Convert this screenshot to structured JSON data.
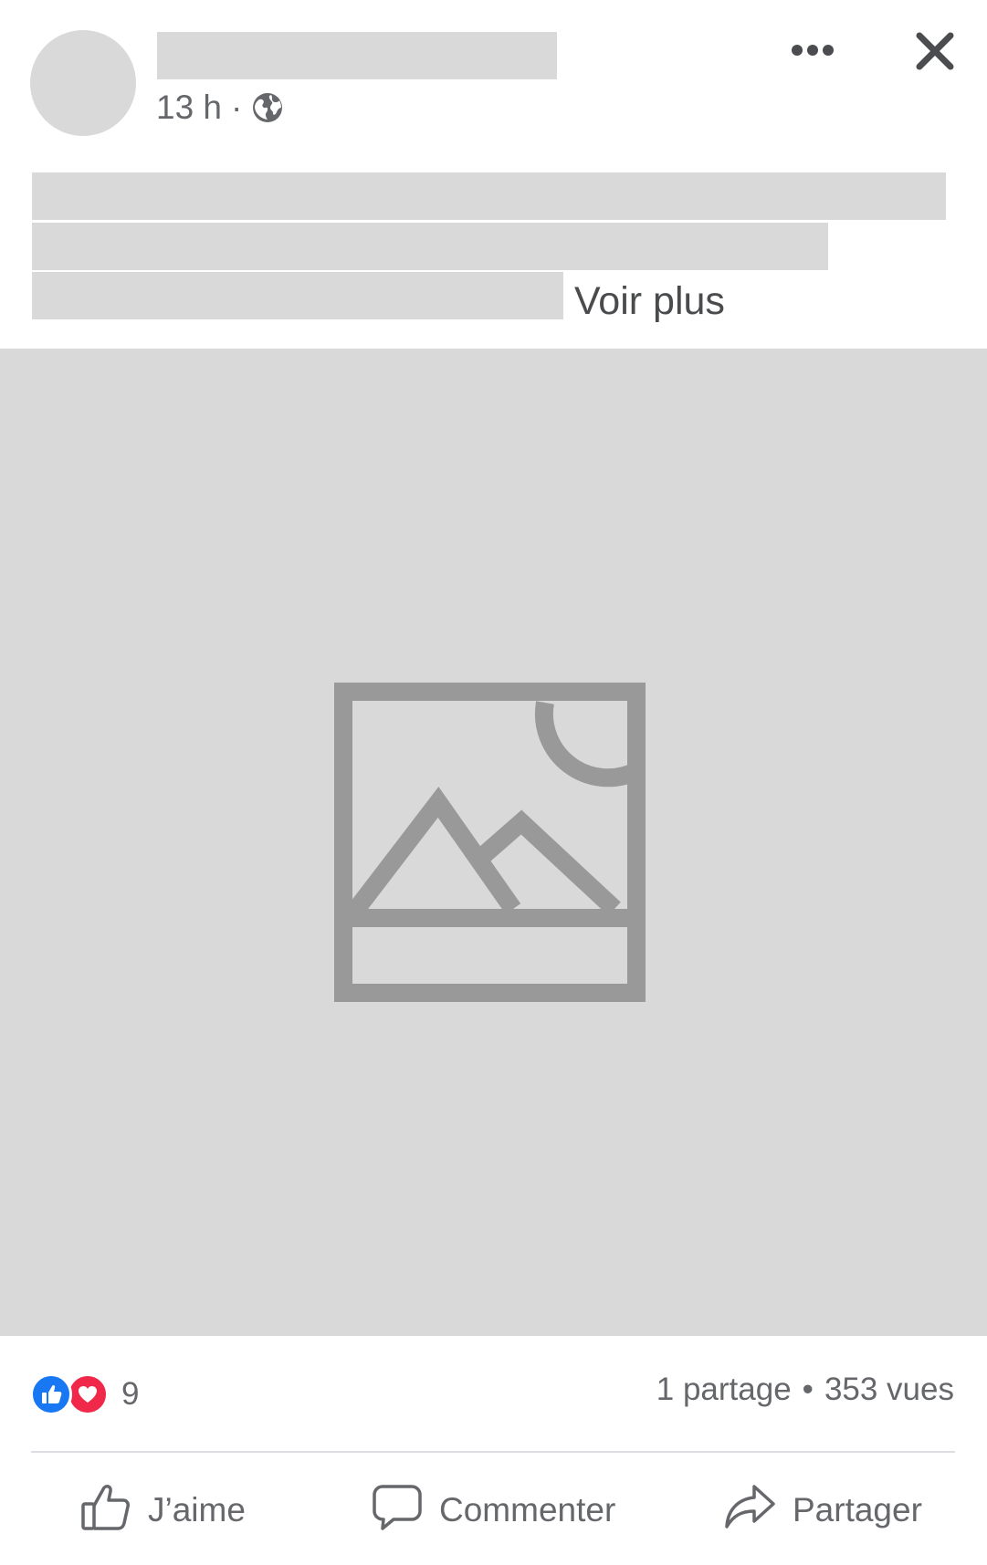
{
  "post": {
    "time": "13 h",
    "separator": "·",
    "audience_icon": "globe-icon",
    "more_icon": "more-horizontal-icon",
    "close_icon": "close-icon",
    "see_more": "Voir plus",
    "media_placeholder_icon": "image-placeholder-icon"
  },
  "stats": {
    "reaction_icons": [
      "like-reaction-icon",
      "love-reaction-icon"
    ],
    "reaction_count": "9",
    "shares": "1 partage",
    "dot": "•",
    "views": "353 vues"
  },
  "actions": {
    "like_label": "J’aime",
    "comment_label": "Commenter",
    "share_label": "Partager"
  },
  "colors": {
    "like_blue": "#1877f2",
    "love_red": "#f02849",
    "placeholder_gray": "#d9d9d9",
    "icon_gray": "#999999",
    "text_gray": "#65676b"
  }
}
